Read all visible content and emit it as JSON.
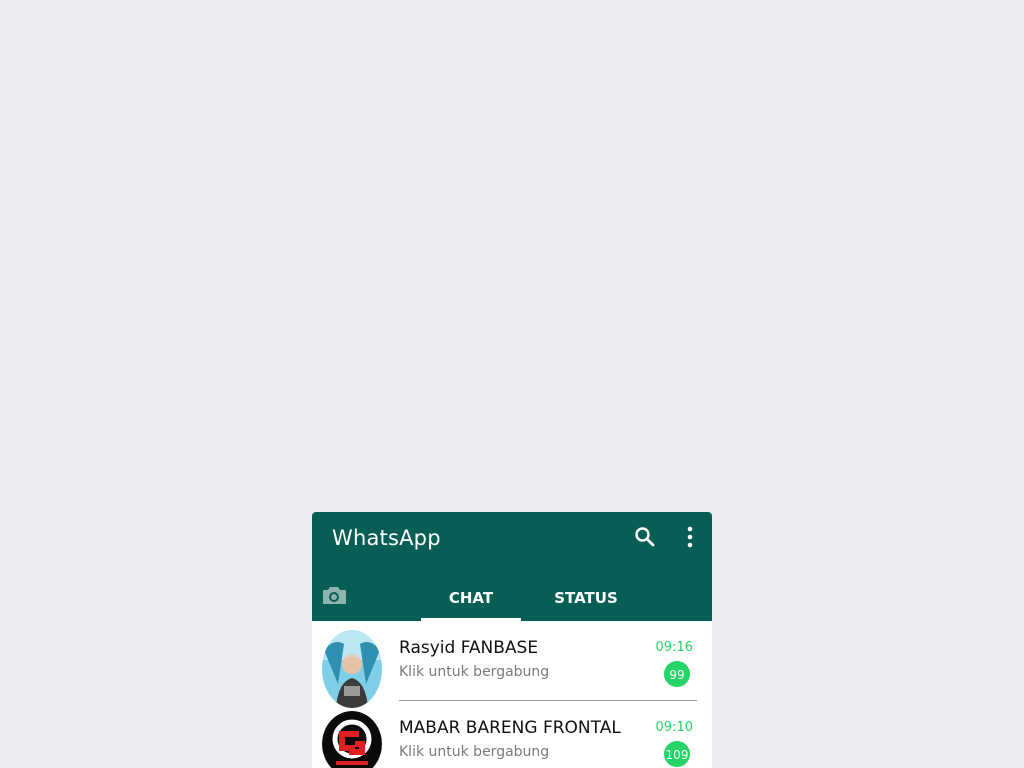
{
  "app": {
    "title": "WhatsApp",
    "header_color": "#075e54",
    "accent_color": "#25d366"
  },
  "toolbar": {
    "search_icon": "search-icon",
    "menu_icon": "more-vert-icon",
    "camera_icon": "camera-icon"
  },
  "tabs": [
    {
      "label": "CHAT",
      "active": true
    },
    {
      "label": "STATUS",
      "active": false
    }
  ],
  "chats": [
    {
      "name": "Rasyid FANBASE",
      "message": "Klik untuk bergabung",
      "time": "09:16",
      "unread": "99"
    },
    {
      "name": "MABAR BARENG FRONTAL",
      "message": "Klik untuk bergabung",
      "time": "09:10",
      "unread": "109"
    }
  ]
}
